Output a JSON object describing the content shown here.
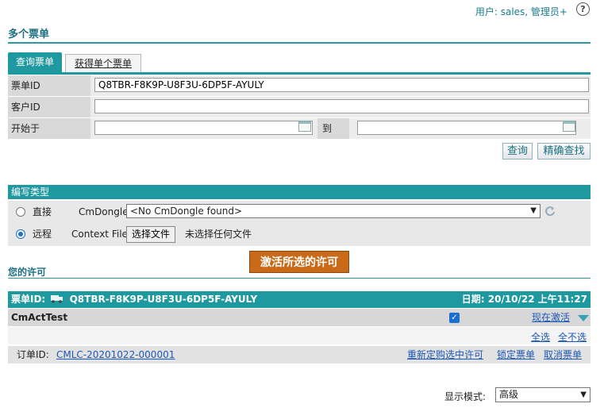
{
  "header": {
    "user_text": "用户: sales, 管理员+",
    "help_glyph": "?",
    "page_title": "多个票单"
  },
  "tabs": {
    "active": "查询票单",
    "other": "获得单个票单"
  },
  "query": {
    "ticket_id_label": "票单ID",
    "ticket_id_value": "Q8TBR-F8K9P-U8F3U-6DP5F-AYULY",
    "customer_id_label": "客户ID",
    "customer_id_value": "",
    "start_label": "开始于",
    "to_label": "到",
    "search_btn": "查询",
    "exact_btn": "精确查找"
  },
  "write_type": {
    "title": "编写类型",
    "direct": "直接",
    "cmdongle_label": "CmDongle",
    "cmdongle_value": "<No CmDongle found>",
    "remote": "远程",
    "context_label": "Context File",
    "choose_file": "选择文件",
    "no_file": "未选择任何文件"
  },
  "activate_btn": "激活所选的许可",
  "your_license": "您的许可",
  "ticket": {
    "id_label": "票单ID:",
    "id_value": "Q8TBR-F8K9P-U8F3U-6DP5F-AYULY",
    "date_label": "日期:",
    "date_value": "20/10/22 上午11:27",
    "product": "CmActTest",
    "activate_now": "现在激活",
    "select_all": "全选",
    "select_none": "全不选",
    "order_label": "订单ID:",
    "order_value": "CMLC-20201022-000001",
    "rebind": "重新定购选中许可",
    "lock": "锁定票单",
    "cancel": "取消票单"
  },
  "display": {
    "label": "显示模式:",
    "value": "高级"
  },
  "colors": {
    "teal": "#1f99a0",
    "link": "#1c58b8",
    "activate": "#c86a18"
  }
}
